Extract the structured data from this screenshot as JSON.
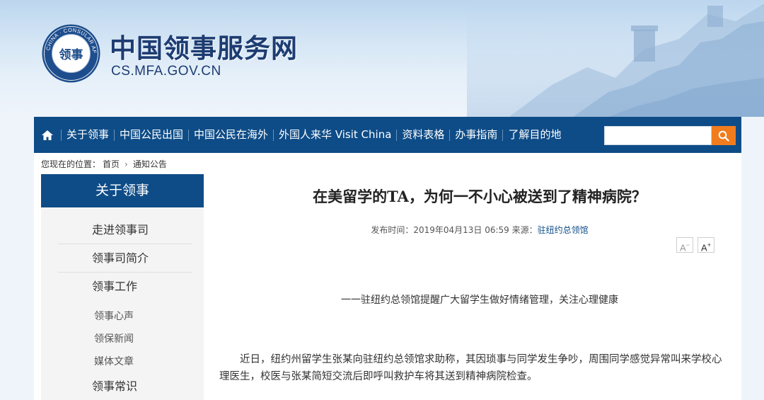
{
  "header": {
    "title": "中国领事服务网",
    "domain": "CS.MFA.GOV.CN",
    "seal_text": "CHINA · CONSULAR AFFAIRS",
    "seal_glyph": "领事"
  },
  "nav": {
    "items": [
      {
        "label": "关于领事"
      },
      {
        "label": "中国公民出国"
      },
      {
        "label": "中国公民在海外"
      },
      {
        "label": "外国人来华 Visit China"
      },
      {
        "label": "资料表格"
      },
      {
        "label": "办事指南"
      },
      {
        "label": "了解目的地"
      }
    ],
    "search_placeholder": "",
    "home_icon": "home-icon",
    "search_icon": "search-icon",
    "accent_color": "#0e4c87",
    "search_color": "#f07c1e"
  },
  "breadcrumb": {
    "prefix": "您现在的位置：",
    "items": [
      "首页",
      "通知公告"
    ]
  },
  "sidebar": {
    "heading": "关于领事",
    "items": [
      "走进领事司",
      "领事司简介",
      "领事工作"
    ],
    "subitems": [
      "领事心声",
      "领保新闻",
      "媒体文章"
    ],
    "tail_item": "领事常识"
  },
  "article": {
    "title": "在美留学的TA，为何一不小心被送到了精神病院？",
    "meta_time_label": "发布时间：",
    "meta_time": "2019年04月13日  06:59",
    "meta_source_label": "来源：",
    "meta_source": "驻纽约总领馆",
    "font_smaller": "A",
    "font_larger": "A",
    "subtitle": "一一驻纽约总领馆提醒广大留学生做好情绪管理，关注心理健康",
    "paragraph1": "近日，纽约州留学生张某向驻纽约总领馆求助称，其因琐事与同学发生争吵，周围同学感觉异常叫来学校心理医生，校医与张某简短交流后即呼叫救护车将其送到精神病院检查。"
  }
}
